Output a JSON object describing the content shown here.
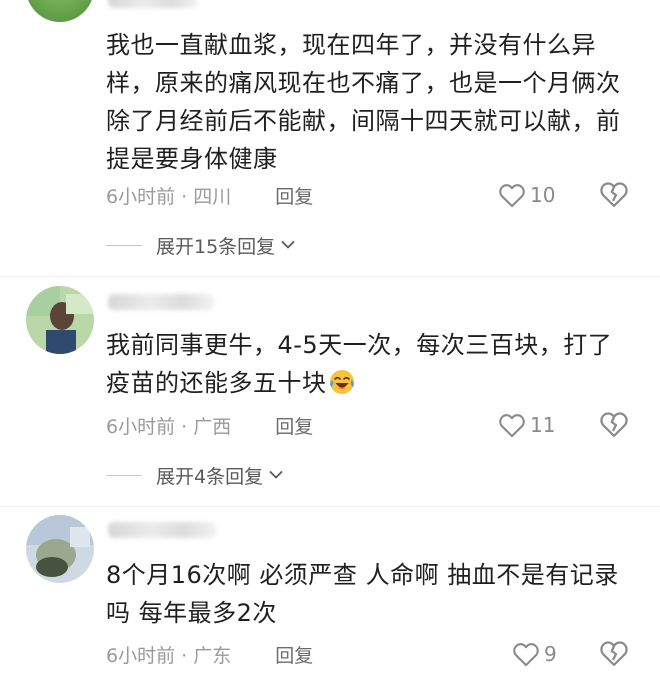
{
  "comments": [
    {
      "text": "我也一直献血浆，现在四年了，并没有什么异样，原来的痛风现在也不痛了，也是一个月俩次除了月经前后不能献，间隔十四天就可以献，前提是要身体健康",
      "time_location": "6小时前 · 四川",
      "reply_label": "回复",
      "likes": "10",
      "expand_label": "展开15条回复"
    },
    {
      "text": "我前同事更牛，4-5天一次，每次三百块，打了疫苗的还能多五十块",
      "time_location": "6小时前 · 广西",
      "reply_label": "回复",
      "likes": "11",
      "expand_label": "展开4条回复"
    },
    {
      "text": "8个月16次啊  必须严查  人命啊 抽血不是有记录吗 每年最多2次",
      "time_location": "6小时前 · 广东",
      "reply_label": "回复",
      "likes": "9"
    }
  ],
  "icons": {
    "like": "heart-outline-icon",
    "dislike": "broken-heart-icon",
    "expand": "chevron-down-icon",
    "emoji": "laughing-tears-emoji"
  },
  "colors": {
    "text": "#1f1f1f",
    "meta": "#9a9a9a",
    "icon": "#8a8a8a"
  }
}
